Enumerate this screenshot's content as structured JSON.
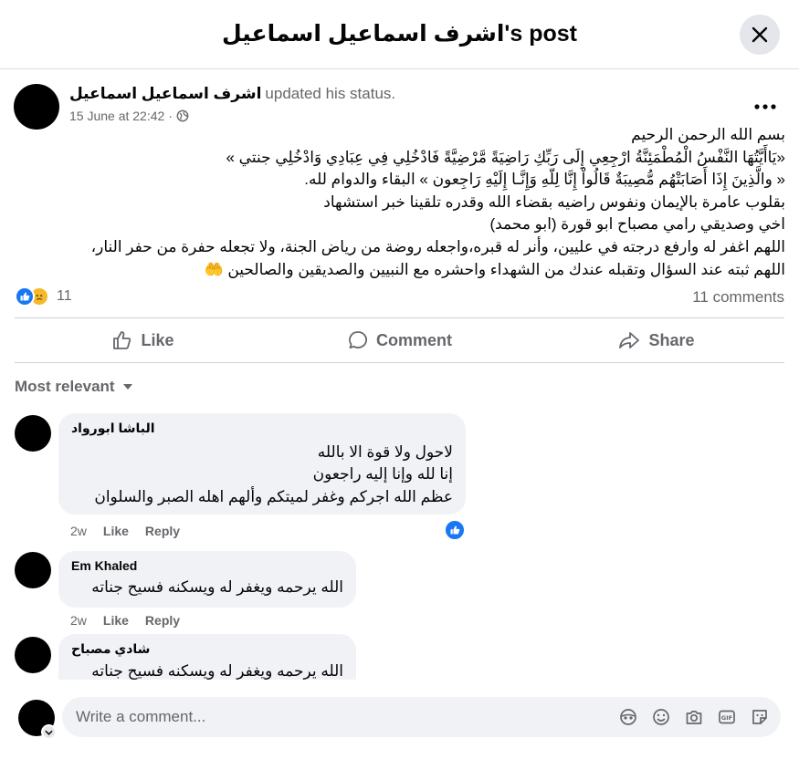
{
  "header": {
    "title": "اشرف اسماعيل اسماعيل's post"
  },
  "post": {
    "author": "اشرف اسماعيل اسماعيل",
    "action": "updated his status.",
    "timestamp": "15 June at 22:42",
    "privacy_icon": "globe-icon",
    "text": "بسم الله الرحمن الرحيم\n«يَاأَيَّتُهَا النَّفْسُ الْمُطْمَئِنَّةُ ارْجِعِي إِلَى رَبِّكِ رَاضِيَةً مَّرْضِيَّةً فَادْخُلِي فِي عِبَادِي وَادْخُلِي جنتي »\n« والَّذِينَ إِذَا أَصَابَتْهُم مُّصِيبَةٌ قَالُواْ إِنَّا لِلّهِ وَإِنَّـا إِلَيْهِ رَاجِعون » البقاء والدوام لله.\nبقلوب عامرة بالإيمان ونفوس راضيه بقضاء الله وقدره  تلقينا خبر استشهاد\nاخي وصديقي رامي مصباح  ابو قورة (ابو محمد)\nاللهم اغفر له وارفع درجته في عليين، وأنر له قبره،واجعله روضة من رياض الجنة، ولا تجعله حفرة من حفر النار،\nاللهم ثبته عند السؤال وتقبله عندك من الشهداء واحشره مع النبيين والصديقين والصالحين 🤲",
    "reactions": {
      "count": "11",
      "types": [
        "like",
        "sad"
      ]
    },
    "comments_count": "11 comments"
  },
  "actions": {
    "like": "Like",
    "comment": "Comment",
    "share": "Share"
  },
  "sort_label": "Most relevant",
  "comments": [
    {
      "name": "الباشا ابورواد",
      "text": "لاحول ولا قوة الا بالله\nإنا لله وإنا إليه راجعون\nعظم الله اجركم وغفر لميتكم وألهم اهله الصبر والسلوان",
      "time": "2w",
      "like": "Like",
      "reply": "Reply",
      "reaction": "like"
    },
    {
      "name": "Em Khaled",
      "text": "الله يرحمه ويغفر له ويسكنه فسيح جناته",
      "time": "2w",
      "like": "Like",
      "reply": "Reply"
    },
    {
      "name": "شادي مصباح",
      "text": "الله يرحمه ويغفر له ويسكنه فسيح جناته"
    }
  ],
  "composer": {
    "placeholder": "Write a comment..."
  },
  "colors": {
    "like_blue": "#1877f2",
    "sad_yellow": "#f7b928",
    "text_secondary": "#65676b",
    "bubble_bg": "#f0f2f5"
  }
}
